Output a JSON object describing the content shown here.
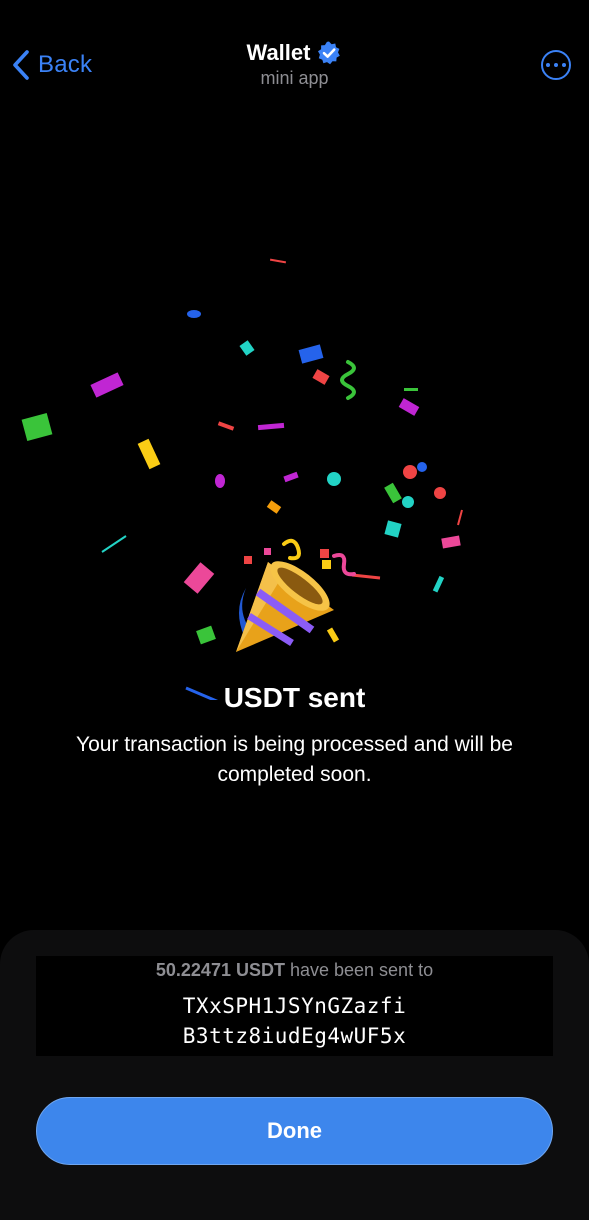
{
  "header": {
    "back_label": "Back",
    "title": "Wallet",
    "subtitle": "mini app"
  },
  "main": {
    "headline": "USDT sent",
    "description": "Your transaction is being processed and will be completed soon."
  },
  "transfer": {
    "amount": "50.22471 USDT",
    "sent_text": " have been sent to",
    "address_line1": "TXxSPH1JSYnGZazfi",
    "address_line2": "B3ttz8iudEg4wUF5x"
  },
  "actions": {
    "done_label": "Done"
  },
  "colors": {
    "accent": "#3b82f6",
    "button": "#3d86ec",
    "background": "#000000",
    "muted_text": "#8e8e93"
  },
  "icons": [
    "chevron-left-icon",
    "verified-badge-icon",
    "more-options-icon",
    "party-popper-icon"
  ]
}
